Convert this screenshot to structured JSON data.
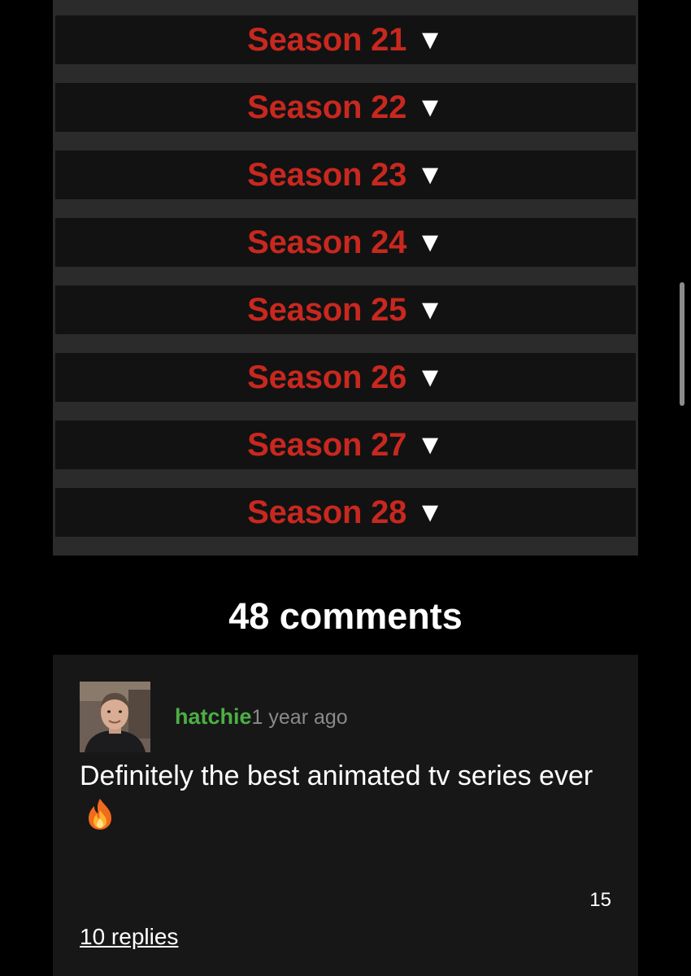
{
  "seasons": [
    {
      "label": "Season 21",
      "arrow": "▼"
    },
    {
      "label": "Season 22",
      "arrow": "▼"
    },
    {
      "label": "Season 23",
      "arrow": "▼"
    },
    {
      "label": "Season 24",
      "arrow": "▼"
    },
    {
      "label": "Season 25",
      "arrow": "▼"
    },
    {
      "label": "Season 26",
      "arrow": "▼"
    },
    {
      "label": "Season 27",
      "arrow": "▼"
    },
    {
      "label": "Season 28",
      "arrow": "▼"
    }
  ],
  "comments": {
    "count_label": "48 comments",
    "items": [
      {
        "username": "hatchie",
        "time": "1 year ago",
        "text": "Definitely the best animated tv series ever",
        "emoji_icon": "fire-icon",
        "likes": "15",
        "replies_label": "10 replies"
      }
    ]
  },
  "colors": {
    "background": "#000000",
    "season_label": "#c8281f",
    "username": "#4caf45",
    "panel_row": "#121212",
    "comment_card": "#171717"
  },
  "icons": {
    "season_toggle": "down-triangle-icon",
    "avatar": "user-avatar-photo",
    "emoji": "fire-icon"
  }
}
